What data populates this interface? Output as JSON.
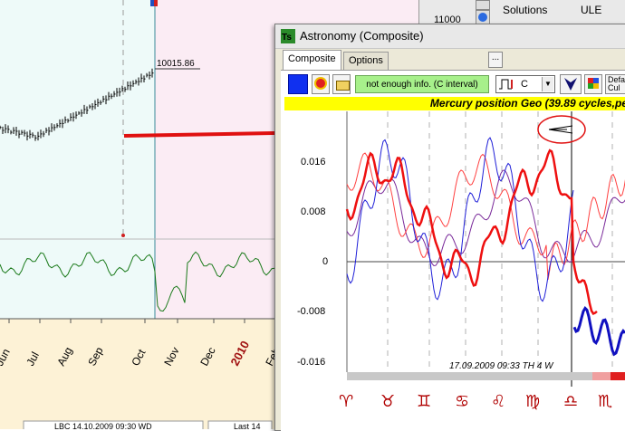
{
  "background_chart": {
    "price_label": "10015.86",
    "months": [
      "Jun",
      "Jul",
      "Aug",
      "Sep",
      "Oct",
      "Nov",
      "Dec",
      "2010",
      "Feb"
    ],
    "year_color": "#a01010",
    "status_left": "LBC 14.10.2009 09:30 WD",
    "status_right": "Last 14"
  },
  "top_panel": {
    "value": "11000",
    "col1": "Solutions",
    "col2": "ULE"
  },
  "window": {
    "title": "Astronomy (Composite)",
    "tabs": [
      {
        "label": "Composite",
        "active": true
      },
      {
        "label": "Options",
        "active": false
      }
    ],
    "ellipsis": "...",
    "toolbar": {
      "status_text": "not enough info. (C interval)",
      "select_value": "C",
      "default_label_1": "Defa",
      "default_label_2": "Cul"
    },
    "chart_header": "Mercury position Geo  (39.89 cycles,peri",
    "y_ticks": [
      "0.016",
      "0.008",
      "0",
      "-0.008",
      "-0.016"
    ],
    "bottom_stamp": "17.09.2009  09:33 TH  4 W",
    "zodiac": [
      "♈",
      "♉",
      "♊",
      "♋",
      "♌",
      "♍",
      "♎",
      "♏"
    ],
    "zodiac_color": "#b00000"
  },
  "colors": {
    "red_line": "#ff2020",
    "blue_line": "#1f1fd8",
    "purple_line": "#7a2a9a",
    "green_line": "#1a7a1a",
    "annotation_arrow": "#e01010",
    "cyan_zone": "#eefaf9",
    "pink_zone": "#fbecf4"
  }
}
